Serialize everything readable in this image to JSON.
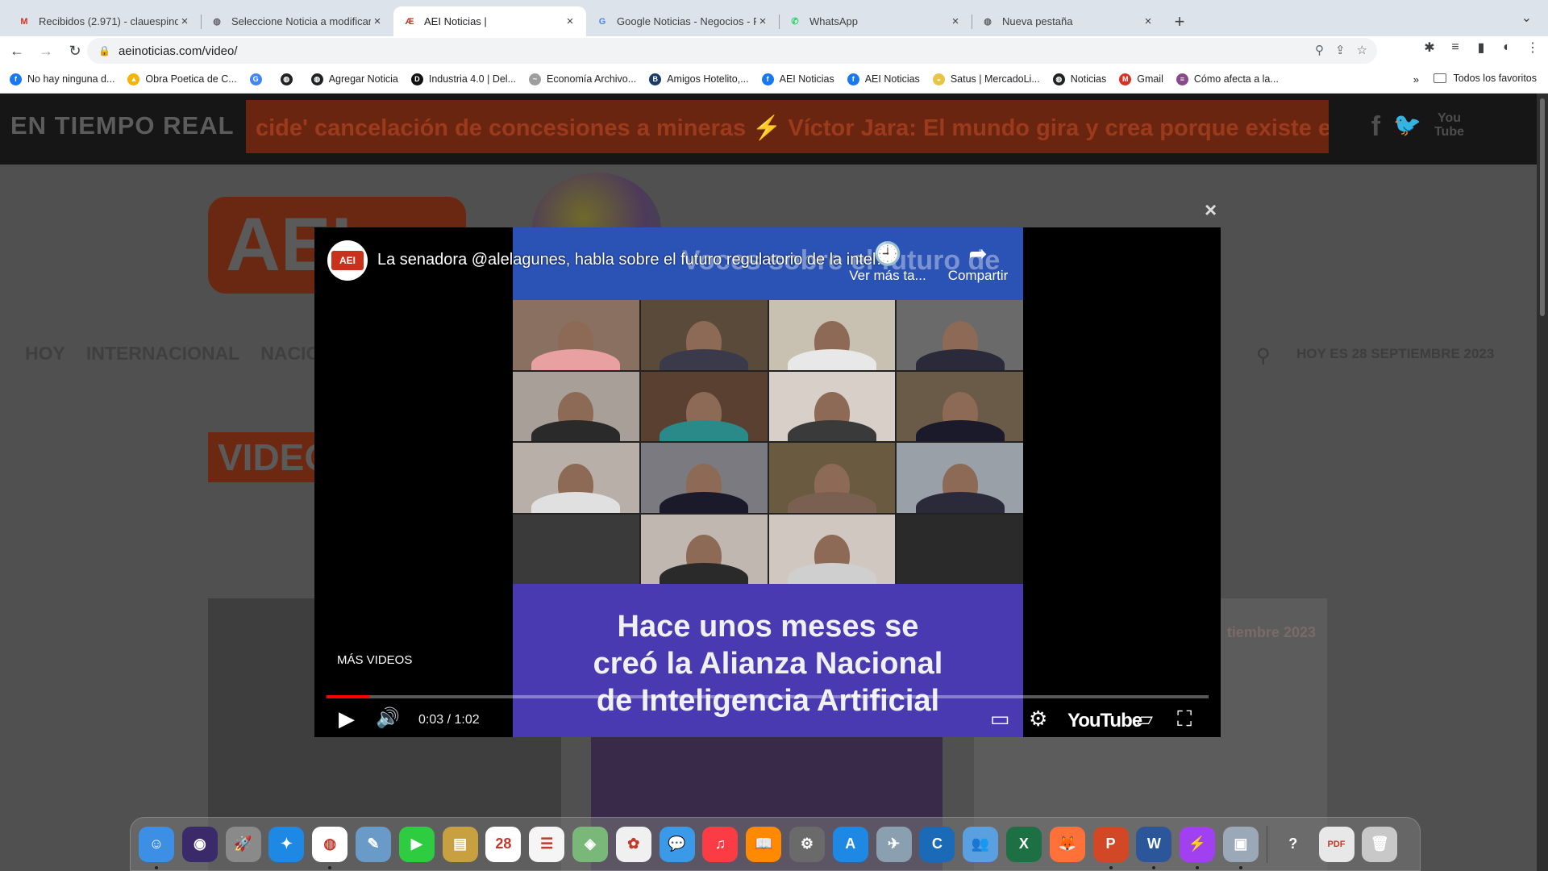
{
  "tabs": [
    {
      "title": "Recibidos (2.971) - clauespind",
      "icon": "gmail-icon",
      "icon_glyph": "M",
      "icon_color": "#d93025",
      "active": false
    },
    {
      "title": "Seleccione Noticia a modificar",
      "icon": "globe-icon",
      "icon_glyph": "◍",
      "icon_color": "#5f6368",
      "active": false
    },
    {
      "title": "AEI Noticias |",
      "icon": "aei-icon",
      "icon_glyph": "Æ",
      "icon_color": "#c8321c",
      "active": true
    },
    {
      "title": "Google Noticias - Negocios - R",
      "icon": "google-news-icon",
      "icon_glyph": "G",
      "icon_color": "#4285f4",
      "active": false
    },
    {
      "title": "WhatsApp",
      "icon": "whatsapp-icon",
      "icon_glyph": "✆",
      "icon_color": "#25d366",
      "active": false
    },
    {
      "title": "Nueva pestaña",
      "icon": "chrome-icon",
      "icon_glyph": "◍",
      "icon_color": "#5f6368",
      "active": false
    }
  ],
  "toolbar": {
    "url": "aeinoticias.com/video/",
    "back": "←",
    "forward": "→",
    "reload": "↻",
    "zoom": "⚲",
    "share": "⇪",
    "star": "☆",
    "extensions": "✱",
    "media": "≡",
    "sidepanel": "▮",
    "profile": "◐",
    "menu": "⋮"
  },
  "bookmarks": [
    {
      "label": "No hay ninguna d...",
      "icon": "facebook-icon",
      "color": "#1877f2",
      "glyph": "f"
    },
    {
      "label": "Obra Poetica de C...",
      "icon": "drive-icon",
      "color": "#f4b400",
      "glyph": "▲"
    },
    {
      "label": "",
      "icon": "google-news-icon",
      "color": "#4285f4",
      "glyph": "G"
    },
    {
      "label": "",
      "icon": "globe-icon",
      "color": "#202124",
      "glyph": "◍"
    },
    {
      "label": "Agregar Noticia",
      "icon": "globe-icon",
      "color": "#202124",
      "glyph": "◍"
    },
    {
      "label": "Industria 4.0 | Del...",
      "icon": "d-icon",
      "color": "#111111",
      "glyph": "D"
    },
    {
      "label": "Economía Archivo...",
      "icon": "smile-icon",
      "color": "#9e9e9e",
      "glyph": "~"
    },
    {
      "label": "Amigos Hotelito,...",
      "icon": "b-icon",
      "color": "#1a3a6a",
      "glyph": "B"
    },
    {
      "label": "AEI Noticias",
      "icon": "facebook-icon",
      "color": "#1877f2",
      "glyph": "f"
    },
    {
      "label": "AEI Noticias",
      "icon": "facebook-icon",
      "color": "#1877f2",
      "glyph": "f"
    },
    {
      "label": "Satus | MercadoLi...",
      "icon": "mercadolibre-icon",
      "color": "#e8c547",
      "glyph": "◒"
    },
    {
      "label": "Noticias",
      "icon": "globe-icon",
      "color": "#202124",
      "glyph": "◍"
    },
    {
      "label": "Gmail",
      "icon": "gmail-icon",
      "color": "#d93025",
      "glyph": "M"
    },
    {
      "label": "Cómo afecta a la...",
      "icon": "news-icon",
      "color": "#8a4a8a",
      "glyph": "≡"
    }
  ],
  "bookmarks_more": "»",
  "bookmarks_all": "Todos los favoritos",
  "page": {
    "ticker_label": "EN TIEMPO REAL",
    "ticker_text": "cide' cancelación de concesiones a mineras  ⚡  Víctor Jara: El mundo gira y crea porque existe el amor  ⚡  AMLO",
    "social": {
      "facebook": "f",
      "twitter": "🐦",
      "youtube_top": "You",
      "youtube_bottom": "Tube"
    },
    "logo_text": "AEI",
    "menu": [
      "HOY",
      "INTERNACIONAL",
      "NACIONAL"
    ],
    "search_glyph": "⚲",
    "date": "HOY ES 28 SEPTIEMBRE 2023",
    "section_title": "VIDEOS",
    "thumb3_label": "tiembre 2023"
  },
  "modal": {
    "close": "×"
  },
  "video": {
    "channel_logo": "AEI",
    "title": "La senadora @alelagunes, habla sobre el futuro regulatorio de la inteligencia artificial",
    "top_band_text": "Voces sobre el futuro de",
    "caption_lines": [
      "Hace unos meses se",
      "creó la Alianza Nacional",
      "de Inteligencia Artificial"
    ],
    "watch_later": "Ver más ta...",
    "watch_later_icon": "🕘",
    "share": "Compartir",
    "share_icon": "➦",
    "more_videos": "MÁS VIDEOS",
    "current_time": "0:03",
    "duration": "1:02",
    "time_display": "0:03 / 1:02",
    "progress": 0.048,
    "play": "▶",
    "volume": "🔊",
    "subtitles": "▭",
    "settings": "⚙",
    "cast": "▱",
    "fullscreen": "⛶",
    "youtube_logo": "YouTube"
  },
  "dock": [
    {
      "name": "finder-icon",
      "bg": "#3d8fe6",
      "glyph": "☺",
      "running": true
    },
    {
      "name": "siri-icon",
      "bg": "#3a2a6a",
      "glyph": "◉",
      "running": false
    },
    {
      "name": "launchpad-icon",
      "bg": "#8a8a8a",
      "glyph": "🚀",
      "running": false
    },
    {
      "name": "safari-icon",
      "bg": "#1e88e5",
      "glyph": "✦",
      "running": false
    },
    {
      "name": "chrome-icon",
      "bg": "#ffffff",
      "glyph": "◍",
      "running": true
    },
    {
      "name": "preview-icon",
      "bg": "#6a9ac8",
      "glyph": "✎",
      "running": false
    },
    {
      "name": "facetime-icon",
      "bg": "#2ecc40",
      "glyph": "▶",
      "running": false
    },
    {
      "name": "notes-book-icon",
      "bg": "#c8a040",
      "glyph": "▤",
      "running": false
    },
    {
      "name": "calendar-icon",
      "bg": "#ffffff",
      "glyph": "28",
      "running": false
    },
    {
      "name": "reminders-icon",
      "bg": "#f5f5f5",
      "glyph": "☰",
      "running": false
    },
    {
      "name": "maps-icon",
      "bg": "#7ab87a",
      "glyph": "◈",
      "running": false
    },
    {
      "name": "photos-icon",
      "bg": "#f0f0f0",
      "glyph": "✿",
      "running": false
    },
    {
      "name": "messages-icon",
      "bg": "#3a9ae8",
      "glyph": "💬",
      "running": false
    },
    {
      "name": "music-icon",
      "bg": "#fc3c44",
      "glyph": "♫",
      "running": false
    },
    {
      "name": "books-icon",
      "bg": "#ff8a00",
      "glyph": "📖",
      "running": false
    },
    {
      "name": "system-settings-icon",
      "bg": "#6a6a6a",
      "glyph": "⚙",
      "running": false
    },
    {
      "name": "app-store-icon",
      "bg": "#1e88e5",
      "glyph": "A",
      "running": false
    },
    {
      "name": "migration-icon",
      "bg": "#8aa0b0",
      "glyph": "✈",
      "running": false
    },
    {
      "name": "c-app-icon",
      "bg": "#1a6ab8",
      "glyph": "C",
      "running": false
    },
    {
      "name": "people-icon",
      "bg": "#5aa0e0",
      "glyph": "👥",
      "running": false
    },
    {
      "name": "excel-icon",
      "bg": "#1d7044",
      "glyph": "X",
      "running": false
    },
    {
      "name": "firefox-icon",
      "bg": "#ff7139",
      "glyph": "🦊",
      "running": false
    },
    {
      "name": "powerpoint-icon",
      "bg": "#d24726",
      "glyph": "P",
      "running": true
    },
    {
      "name": "word-icon",
      "bg": "#2b579a",
      "glyph": "W",
      "running": true
    },
    {
      "name": "messenger-icon",
      "bg": "#a040f0",
      "glyph": "⚡",
      "running": true
    },
    {
      "name": "screenshot-icon",
      "bg": "#9aa8b8",
      "glyph": "▣",
      "running": true
    },
    {
      "name": "help-icon",
      "bg": "transparent",
      "glyph": "?",
      "running": false,
      "sep_before": true
    },
    {
      "name": "pdf-icon",
      "bg": "#e8e8e8",
      "glyph": "PDF",
      "running": false
    },
    {
      "name": "trash-icon",
      "bg": "#c8c8c8",
      "glyph": "🗑",
      "running": false
    }
  ]
}
